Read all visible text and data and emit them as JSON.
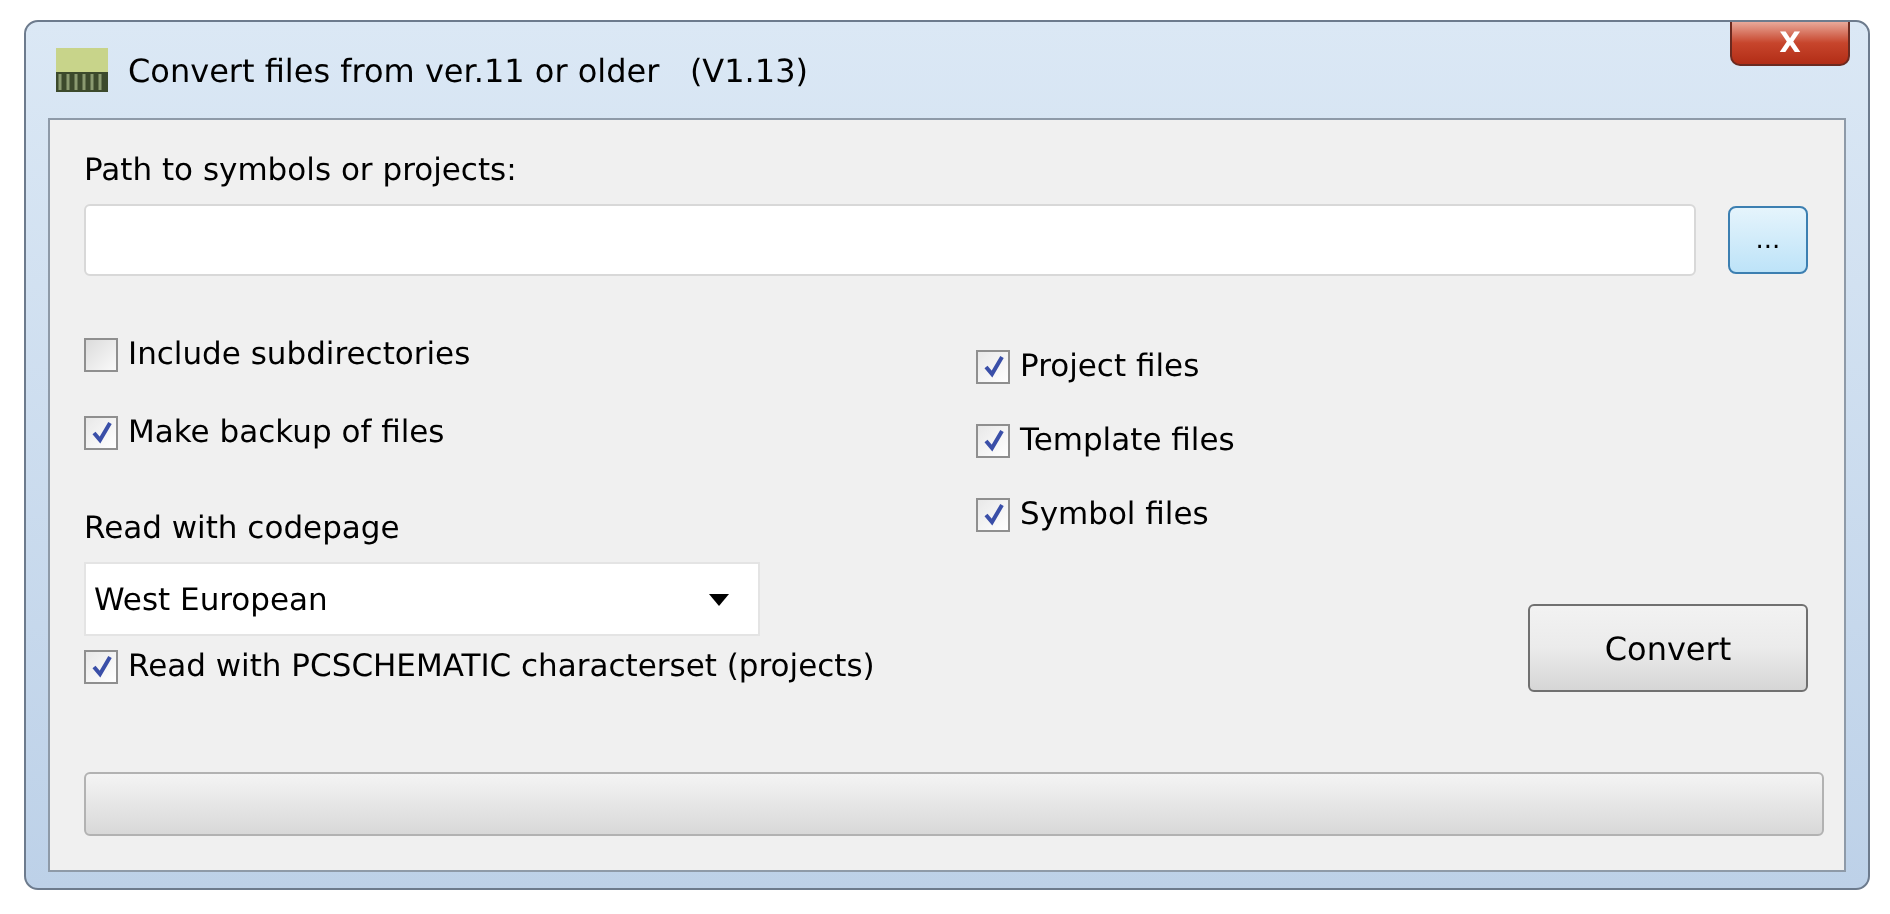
{
  "window": {
    "title": "Convert files from ver.11 or older   (V1.13)",
    "close": "X"
  },
  "path": {
    "label": "Path to symbols or projects:",
    "browse": "..."
  },
  "left_options": [
    {
      "label": "Include subdirectories",
      "checked": false
    },
    {
      "label": "Make backup of files",
      "checked": true
    }
  ],
  "file_types": [
    {
      "label": "Project files",
      "checked": true
    },
    {
      "label": "Template files",
      "checked": true
    },
    {
      "label": "Symbol files",
      "checked": true
    }
  ],
  "codepage": {
    "label": "Read with codepage",
    "value": "West European"
  },
  "charset_option": {
    "label": "Read with PCSCHEMATIC characterset (projects)",
    "checked": true
  },
  "convert_button": "Convert",
  "progress": {
    "level": 0
  }
}
